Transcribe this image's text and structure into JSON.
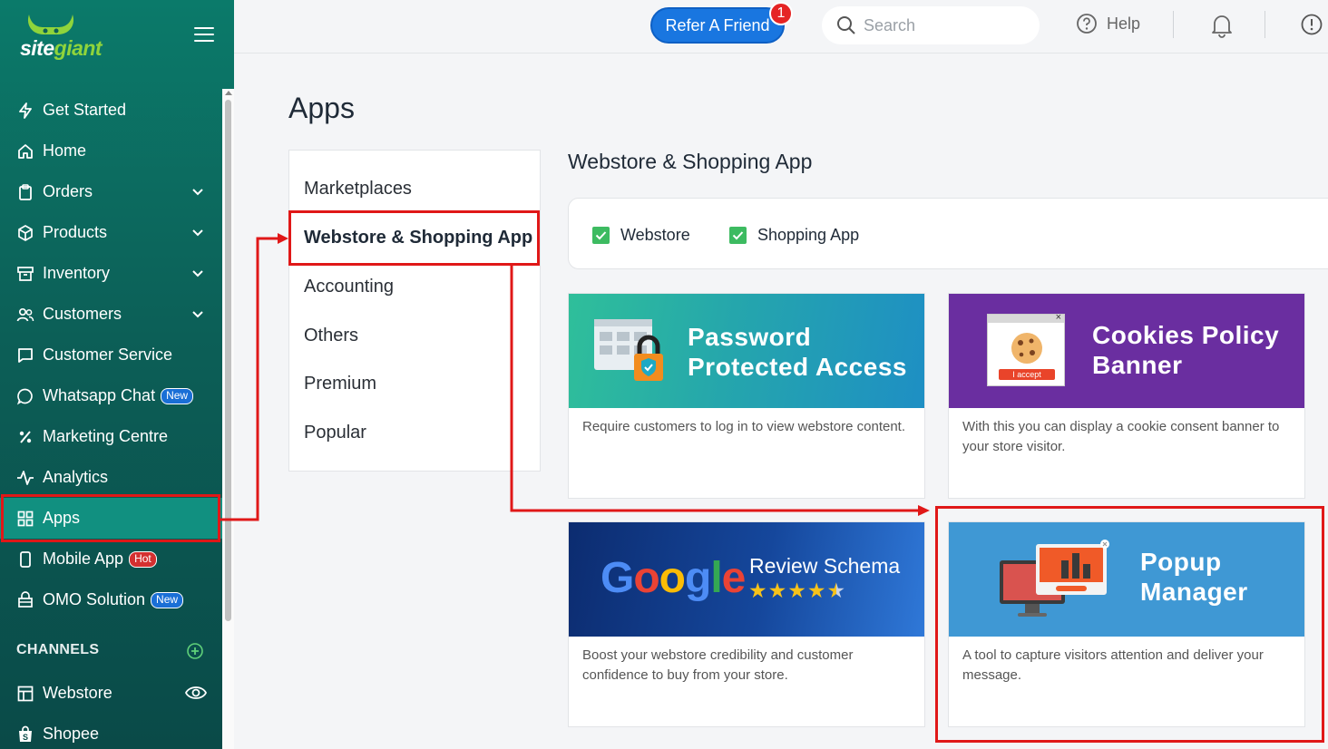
{
  "brand": {
    "name_main": "site",
    "name_accent": "giant"
  },
  "sidebar": {
    "items": [
      {
        "label": "Get Started",
        "icon": "bolt-icon"
      },
      {
        "label": "Home",
        "icon": "home-icon"
      },
      {
        "label": "Orders",
        "icon": "clipboard-icon",
        "expandable": true
      },
      {
        "label": "Products",
        "icon": "box-icon",
        "expandable": true
      },
      {
        "label": "Inventory",
        "icon": "inventory-icon",
        "expandable": true
      },
      {
        "label": "Customers",
        "icon": "users-icon",
        "expandable": true
      },
      {
        "label": "Customer Service",
        "icon": "chat-icon"
      },
      {
        "label": "Whatsapp Chat",
        "icon": "whatsapp-icon",
        "badge": "New"
      },
      {
        "label": "Marketing Centre",
        "icon": "percent-icon"
      },
      {
        "label": "Analytics",
        "icon": "pulse-icon"
      },
      {
        "label": "Apps",
        "icon": "grid-icon",
        "active": true
      },
      {
        "label": "Mobile App",
        "icon": "phone-icon",
        "badge": "Hot"
      },
      {
        "label": "OMO Solution",
        "icon": "store-icon",
        "badge": "New"
      }
    ],
    "channels_heading": "CHANNELS",
    "channels": [
      {
        "label": "Webstore",
        "icon": "layout-icon"
      },
      {
        "label": "Shopee",
        "icon": "shopee-bag-icon"
      }
    ]
  },
  "topbar": {
    "refer_label": "Refer A Friend",
    "refer_count": "1",
    "search_placeholder": "Search",
    "help_label": "Help"
  },
  "main": {
    "title": "Apps",
    "categories": [
      "Marketplaces",
      "Webstore & Shopping App",
      "Accounting",
      "Others",
      "Premium",
      "Popular"
    ],
    "active_category": "Webstore & Shopping App",
    "section_title": "Webstore & Shopping App",
    "filters": [
      {
        "label": "Webstore",
        "checked": true
      },
      {
        "label": "Shopping App",
        "checked": true
      }
    ],
    "apps": [
      {
        "title_line1": "Password",
        "title_line2": "Protected Access",
        "description": "Require customers to log in to view webstore content."
      },
      {
        "title_line1": "Cookies Policy",
        "title_line2": "Banner",
        "badge_text": "I accept",
        "description": "With this you can display a cookie consent banner to your store visitor."
      },
      {
        "logo": "Google",
        "subtitle": "Review Schema",
        "rating": "4.5",
        "description": "Boost your webstore credibility and customer confidence to buy from your store."
      },
      {
        "title_line1": "Popup",
        "title_line2": "Manager",
        "description": "A tool to capture visitors attention and deliver your message."
      }
    ]
  },
  "colors": {
    "sidebar": "#0c5f57",
    "accent": "#1976e0",
    "active_item": "#119080",
    "highlight": "#e01818",
    "check": "#3dbb61"
  }
}
